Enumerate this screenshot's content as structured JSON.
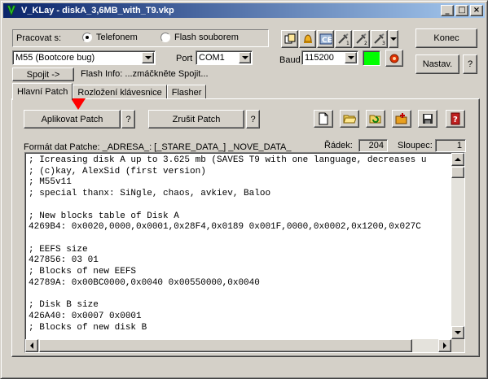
{
  "window": {
    "title": "V_KLay - diskA_3,6MB_with_T9.vkp",
    "minimize": "_",
    "maximize": "□",
    "close": "×"
  },
  "connection": {
    "label": "Pracovat s:",
    "option_phone": "Telefonem",
    "option_flash": "Flash souborem",
    "selected": "Telefonem",
    "model_value": "M55 (Bootcore bug)",
    "port_label": "Port",
    "port_value": "COM1",
    "baud_label": "Baud",
    "baud_value": "115200",
    "status_color": "#00ff00",
    "connect_button": "Spojit ->",
    "flash_info": "Flash Info: ...zmáčkněte Spojit..."
  },
  "right_buttons": {
    "exit": "Konec",
    "settings": "Nastav.",
    "help": "?"
  },
  "toolbar_icons": [
    "phonebook-icon",
    "bell-icon",
    "ce-icon",
    "tool-1-icon",
    "tool-2-icon",
    "tool-3-icon"
  ],
  "tabs": [
    "Hlavní Patch",
    "Rozložení klávesnice",
    "Flasher"
  ],
  "patch": {
    "apply_button": "Aplikovat Patch",
    "apply_help": "?",
    "cancel_button": "Zrušit Patch",
    "cancel_help": "?",
    "format_text": "Formát dat Patche: _ADRESA_: [_STARE_DATA_] _NOVE_DATA_",
    "row_label": "Řádek:",
    "row_value": "204",
    "col_label": "Sloupec:",
    "col_value": "1",
    "lines": [
      "; Icreasing disk A up to 3.625 mb (SAVES T9 with one language, decreases u",
      "; (c)kay, AlexSid (first version)",
      "; M55v11",
      "; special thanx: SiNgle, chaos, avkiev, Baloo",
      "",
      "; New blocks table of Disk A",
      "4269B4: 0x0020,0000,0x0001,0x28F4,0x0189 0x001F,0000,0x0002,0x1200,0x027C",
      "",
      "; EEFS size",
      "427856: 03 01",
      "; Blocks of new EEFS",
      "42789A: 0x00BC0000,0x0040 0x00550000,0x0040",
      "",
      "; Disk B size",
      "426A40: 0x0007 0x0001",
      "; Blocks of new disk B"
    ]
  },
  "file_icons": [
    "new-file-icon",
    "open-folder-icon",
    "reload-icon",
    "folder-add-icon",
    "save-icon",
    "help-book-icon"
  ]
}
